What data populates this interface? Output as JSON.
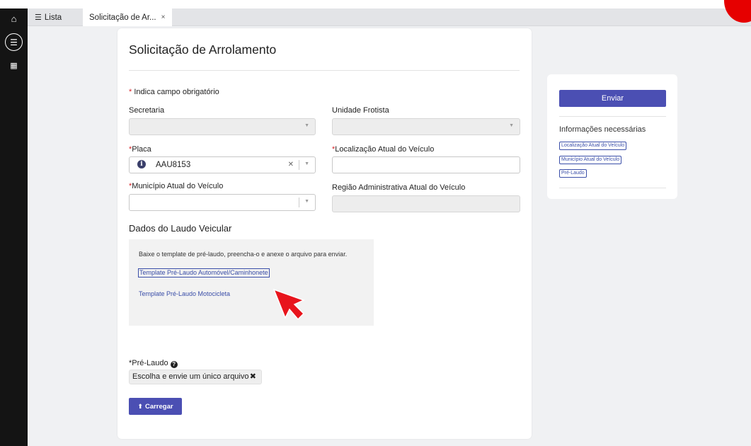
{
  "tabs": {
    "list_label": "Lista",
    "active_label": "Solicitação de Ar...",
    "close_glyph": "×"
  },
  "form": {
    "title": "Solicitação de Arrolamento",
    "required_note": "Indica campo obrigatório",
    "required_marker": "*",
    "secretaria_label": "Secretaria",
    "unidade_label": "Unidade Frotista",
    "placa_label": "Placa",
    "placa_value": "AAU8153",
    "localizacao_label": "Localização Atual do Veículo",
    "municipio_label": "Município Atual do Veículo",
    "regiao_label": "Região Administrativa Atual do Veículo"
  },
  "laudo": {
    "section_title": "Dados do Laudo Veicular",
    "instructions": "Baixe o template de pré-laudo, preencha-o e anexe o arquivo para enviar.",
    "link_auto": "Template Pré-Laudo Automóvel/Caminhonete",
    "link_moto": "Template Pré-Laudo Motocicleta"
  },
  "upload": {
    "label": "Pré-Laudo",
    "chooser_text": "Escolha e envie um único arquivo",
    "button_label": "Carregar"
  },
  "sidebar": {
    "send_label": "Enviar",
    "info_title": "Informações necessárias",
    "chips": [
      "Localização Atual do Veículo",
      "Município Atual do Veículo",
      "Pré-Laudo"
    ]
  },
  "colors": {
    "primary": "#4b4fb3",
    "required": "#d9262a",
    "link": "#3a4ea8",
    "cursor": "#e8141c"
  }
}
